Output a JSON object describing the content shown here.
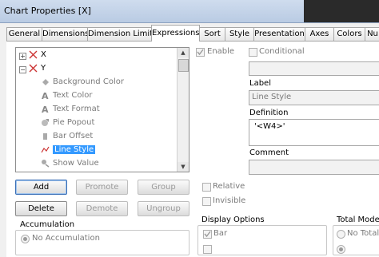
{
  "window": {
    "title": "Chart Properties [X]"
  },
  "tabs": [
    {
      "label": "General"
    },
    {
      "label": "Dimensions"
    },
    {
      "label": "Dimension Limits"
    },
    {
      "label": "Expressions"
    },
    {
      "label": "Sort"
    },
    {
      "label": "Style"
    },
    {
      "label": "Presentation"
    },
    {
      "label": "Axes"
    },
    {
      "label": "Colors"
    },
    {
      "label": "Nu"
    }
  ],
  "active_tab": "Expressions",
  "tree": {
    "items": [
      {
        "label": "X"
      },
      {
        "label": "Y"
      },
      {
        "label": "Background Color"
      },
      {
        "label": "Text Color"
      },
      {
        "label": "Text Format"
      },
      {
        "label": "Pie Popout"
      },
      {
        "label": "Bar Offset"
      },
      {
        "label": "Line Style"
      },
      {
        "label": "Show Value"
      }
    ],
    "selected": "Line Style"
  },
  "buttons": {
    "add": "Add",
    "promote": "Promote",
    "group": "Group",
    "delete": "Delete",
    "demote": "Demote",
    "ungroup": "Ungroup"
  },
  "accumulation": {
    "title": "Accumulation",
    "option": "No Accumulation"
  },
  "options": {
    "enable": "Enable",
    "conditional": "Conditional",
    "relative": "Relative",
    "invisible": "Invisible"
  },
  "fields": {
    "label_title": "Label",
    "label_value": "Line Style",
    "definition_title": "Definition",
    "definition_value": "'<W4>'",
    "comment_title": "Comment"
  },
  "display_options": {
    "title": "Display Options",
    "bar": "Bar"
  },
  "total_mode": {
    "title": "Total Mode",
    "option": "No Totals"
  }
}
